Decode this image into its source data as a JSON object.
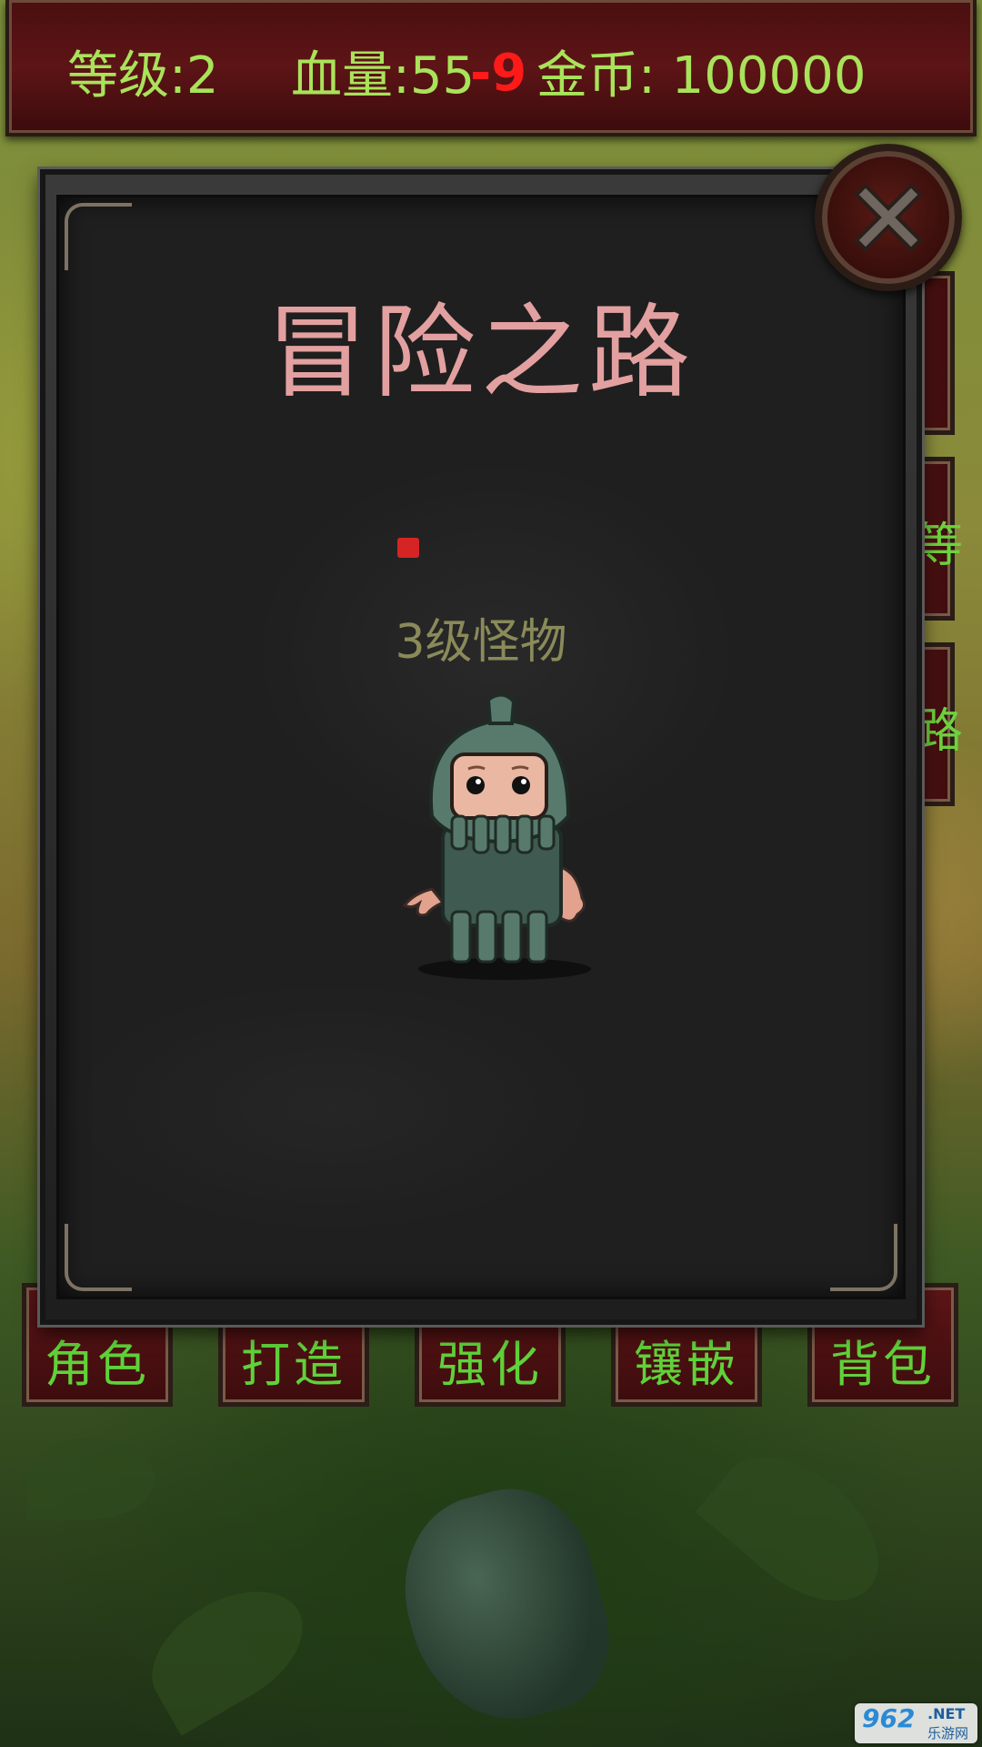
{
  "status_bar": {
    "level": "等级:2",
    "hp": "血量:55",
    "hp_delta": "-9",
    "gold": "金币: 100000"
  },
  "panel": {
    "title": "冒险之路",
    "monster_label": "3级怪物",
    "close_icon": "close-x-icon"
  },
  "side_buttons": [
    {
      "label": ""
    },
    {
      "label": "等"
    },
    {
      "label": "路"
    }
  ],
  "bottom_nav": [
    {
      "label": "角色"
    },
    {
      "label": "打造"
    },
    {
      "label": "强化"
    },
    {
      "label": "镶嵌"
    },
    {
      "label": "背包"
    }
  ],
  "watermark": {
    "brand": "962",
    "domain": ".NET",
    "subtitle": "乐游网"
  },
  "colors": {
    "stat_text": "#a9e35a",
    "damage": "#ff1a1a",
    "title": "#e3a0a0",
    "button_text": "#5fd23a",
    "panel_bg": "#1f1f1f",
    "bar_bg": "#5d1416"
  }
}
